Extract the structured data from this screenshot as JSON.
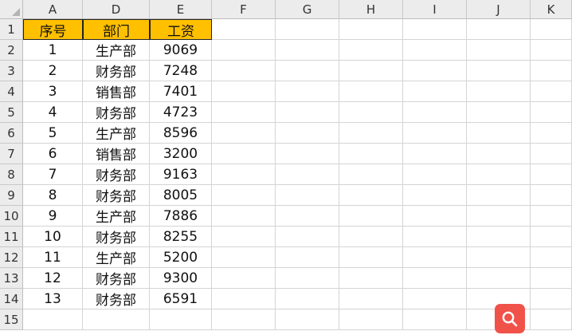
{
  "columns": [
    "A",
    "D",
    "E",
    "F",
    "G",
    "H",
    "I",
    "J",
    "K"
  ],
  "rows": [
    "1",
    "2",
    "3",
    "4",
    "5",
    "6",
    "7",
    "8",
    "9",
    "10",
    "11",
    "12",
    "13",
    "14",
    "15"
  ],
  "headers": [
    "序号",
    "部门",
    "工资"
  ],
  "data": [
    [
      "1",
      "生产部",
      "9069"
    ],
    [
      "2",
      "财务部",
      "7248"
    ],
    [
      "3",
      "销售部",
      "7401"
    ],
    [
      "4",
      "财务部",
      "4723"
    ],
    [
      "5",
      "生产部",
      "8596"
    ],
    [
      "6",
      "销售部",
      "3200"
    ],
    [
      "7",
      "财务部",
      "9163"
    ],
    [
      "8",
      "财务部",
      "8005"
    ],
    [
      "9",
      "生产部",
      "7886"
    ],
    [
      "10",
      "财务部",
      "8255"
    ],
    [
      "11",
      "生产部",
      "5200"
    ],
    [
      "12",
      "财务部",
      "9300"
    ],
    [
      "13",
      "财务部",
      "6591"
    ]
  ],
  "colors": {
    "header_fill": "#ffc000",
    "search_button": "#f0524a"
  },
  "icons": {
    "search_button": "magnifier-icon"
  }
}
